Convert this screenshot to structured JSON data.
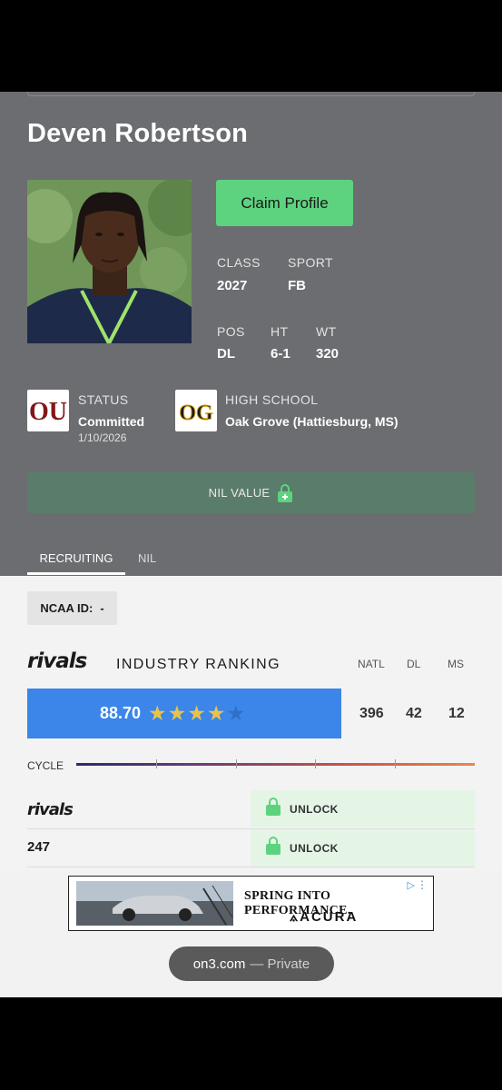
{
  "player": {
    "name": "Deven Robertson",
    "claim_label": "Claim Profile"
  },
  "info": {
    "class_label": "CLASS",
    "class_value": "2027",
    "sport_label": "SPORT",
    "sport_value": "FB",
    "pos_label": "POS",
    "pos_value": "DL",
    "ht_label": "HT",
    "ht_value": "6-1",
    "wt_label": "WT",
    "wt_value": "320"
  },
  "status": {
    "label": "STATUS",
    "value": "Committed",
    "date": "1/10/2026",
    "school_logo_text": "OU"
  },
  "high_school": {
    "label": "HIGH SCHOOL",
    "value": "Oak Grove (Hattiesburg, MS)",
    "logo_text": "OG"
  },
  "nil": {
    "label": "NIL VALUE"
  },
  "tabs": [
    {
      "label": "RECRUITING",
      "active": true
    },
    {
      "label": "NIL",
      "active": false
    }
  ],
  "ncaa": {
    "label": "NCAA ID:",
    "value": "-"
  },
  "industry": {
    "brand": "rivals",
    "title": "INDUSTRY RANKING",
    "columns": [
      "NATL",
      "DL",
      "MS"
    ],
    "rating": "88.70",
    "stars": 4,
    "max_stars": 5,
    "ranks": [
      "396",
      "42",
      "12"
    ]
  },
  "cycle": {
    "label": "CYCLE"
  },
  "services": [
    {
      "name": "rivals",
      "action": "UNLOCK"
    },
    {
      "name": "247",
      "action": "UNLOCK"
    }
  ],
  "ad": {
    "headline": "SPRING INTO PERFORMANCE.",
    "brand": "ACURA"
  },
  "browser": {
    "domain": "on3.com",
    "mode": "— Private"
  },
  "colors": {
    "header_bg": "#6b6d70",
    "claim_green": "#5ed37f",
    "rating_blue": "#3b86e8",
    "star_gold": "#e8c24a",
    "unlock_bg": "#e4f5e6",
    "ou_crimson": "#841617"
  }
}
